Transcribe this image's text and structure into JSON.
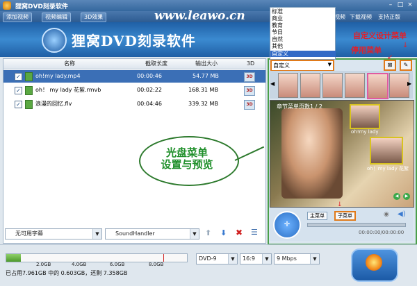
{
  "window": {
    "title": "狸窝DVD刻录软件"
  },
  "toolbar": {
    "add_video": "添加视频",
    "edit_video": "视频编辑",
    "effect_3d": "3D效果",
    "links": [
      "视频",
      "下载视频",
      "支持正版"
    ]
  },
  "banner": {
    "title": "狸窝DVD刻录软件",
    "url": "www.leawo.cn"
  },
  "table": {
    "headers": [
      "名称",
      "截取长度",
      "输出大小",
      "3D"
    ],
    "rows": [
      {
        "checked": true,
        "name": "oh!my lady.mp4",
        "duration": "00:00:46",
        "size": "54.77 MB",
        "selected": true
      },
      {
        "checked": true,
        "name": "oh！ my lady 花絮.rmvb",
        "duration": "00:02:22",
        "size": "168.31 MB",
        "selected": false
      },
      {
        "checked": true,
        "name": "浪漫的回忆.flv",
        "duration": "00:04:46",
        "size": "339.32 MB",
        "selected": false
      }
    ]
  },
  "subtitle_select": {
    "value": "无可用字幕"
  },
  "audio_select": {
    "value": "SoundHandler"
  },
  "menu_templates": {
    "options": [
      "标准",
      "商业",
      "教育",
      "节日",
      "自然",
      "其他",
      "自定义"
    ],
    "selected": "自定义"
  },
  "preview": {
    "page_label": "章节菜单页数1 / 2",
    "items": [
      "oh!my lady",
      "oh！my lady 花絮"
    ]
  },
  "player": {
    "main_menu": "主菜单",
    "sub_menu": "子菜单",
    "time": "00:00:00/00:00:00"
  },
  "capacity": {
    "marks": [
      "2.0GB",
      "4.0GB",
      "6.0GB",
      "8.0GB"
    ],
    "used_fraction": 0.08,
    "status": "已占用7.961GB 中的 0.603GB，还剩 7.358GB"
  },
  "output": {
    "disc": "DVD-9",
    "aspect": "16:9",
    "bitrate": "9 Mbps"
  },
  "annotations": {
    "custom_menu": "自定义设计菜单",
    "disable_menu": "停用菜单",
    "bubble_line1": "光盘菜单",
    "bubble_line2": "设置与预览"
  },
  "colors": {
    "accent": "#3b6fb6",
    "highlight_border": "#e07a1a",
    "annotation_red": "#e0202a",
    "preview_border": "#4aa04a"
  }
}
